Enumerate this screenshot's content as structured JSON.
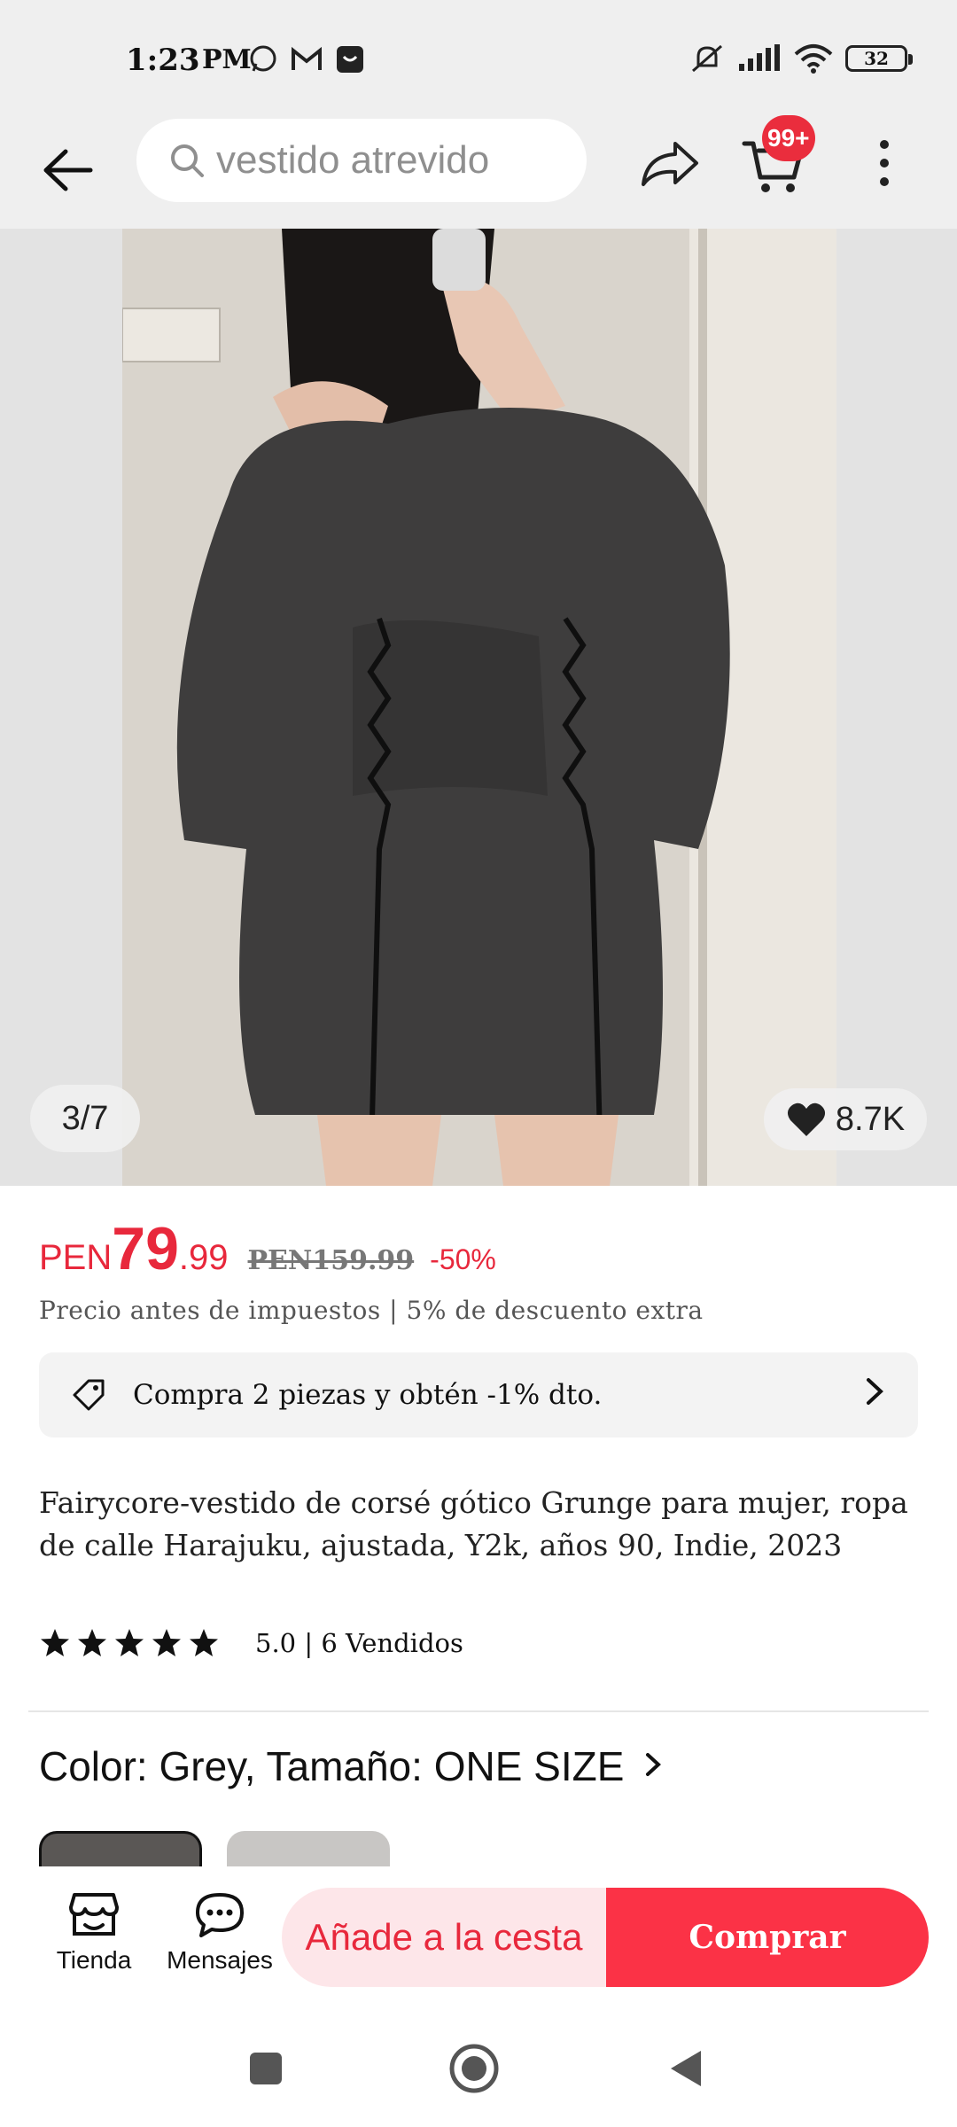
{
  "status_bar": {
    "time": "1:23",
    "ampm": "PM",
    "battery": "32"
  },
  "header": {
    "search_placeholder": "vestido atrevido",
    "cart_badge": "99+"
  },
  "gallery": {
    "counter": "3/7",
    "likes": "8.7K"
  },
  "price": {
    "currency": "PEN",
    "integer": "79",
    "decimal": ".99",
    "original": "PEN159.99",
    "discount": "-50%",
    "tax_note": "Precio antes de impuestos | 5% de descuento extra"
  },
  "promo": {
    "text": "Compra 2 piezas y obtén -1% dto."
  },
  "product": {
    "title": "Fairycore-vestido de corsé gótico Grunge para mujer, ropa de calle Harajuku, ajustada, Y2k, años 90, Indie, 2023",
    "rating": 5.0,
    "rating_text": "5.0  |  6 Vendidos"
  },
  "variant": {
    "label": "Color: Grey, Tamaño: ONE SIZE"
  },
  "actions": {
    "store": "Tienda",
    "messages": "Mensajes",
    "add_to_cart": "Añade a la cesta",
    "buy": "Comprar"
  },
  "colors": {
    "accent": "#e8283c",
    "buy_bg": "#fb3246",
    "cart_bg": "#fde6e9"
  }
}
